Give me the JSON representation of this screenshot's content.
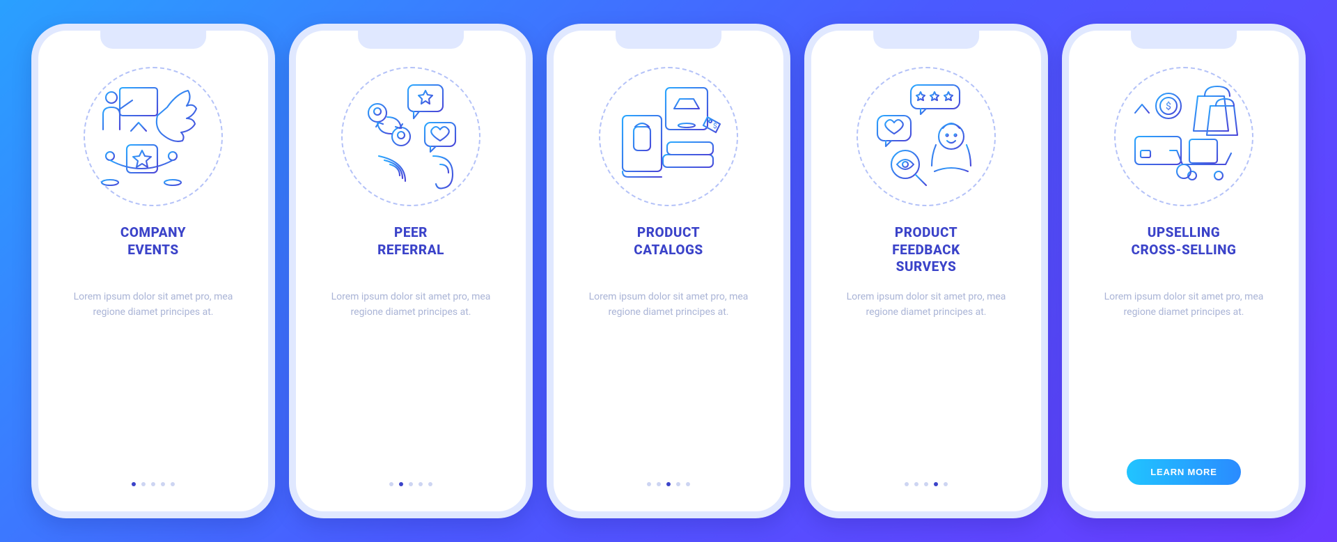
{
  "cta_label": "LEARN MORE",
  "lorem": "Lorem ipsum dolor sit amet pro, mea regione diamet principes at.",
  "screens": [
    {
      "title": "COMPANY\nEVENTS",
      "icon": "events-illustration",
      "active_dot": 0
    },
    {
      "title": "PEER\nREFERRAL",
      "icon": "referral-illustration",
      "active_dot": 1
    },
    {
      "title": "PRODUCT\nCATALOGS",
      "icon": "catalogs-illustration",
      "active_dot": 2
    },
    {
      "title": "PRODUCT\nFEEDBACK\nSURVEYS",
      "icon": "feedback-illustration",
      "active_dot": 3
    },
    {
      "title": "UPSELLING\nCROSS-SELLING",
      "icon": "upsell-illustration",
      "active_dot": 4,
      "cta": true
    }
  ]
}
